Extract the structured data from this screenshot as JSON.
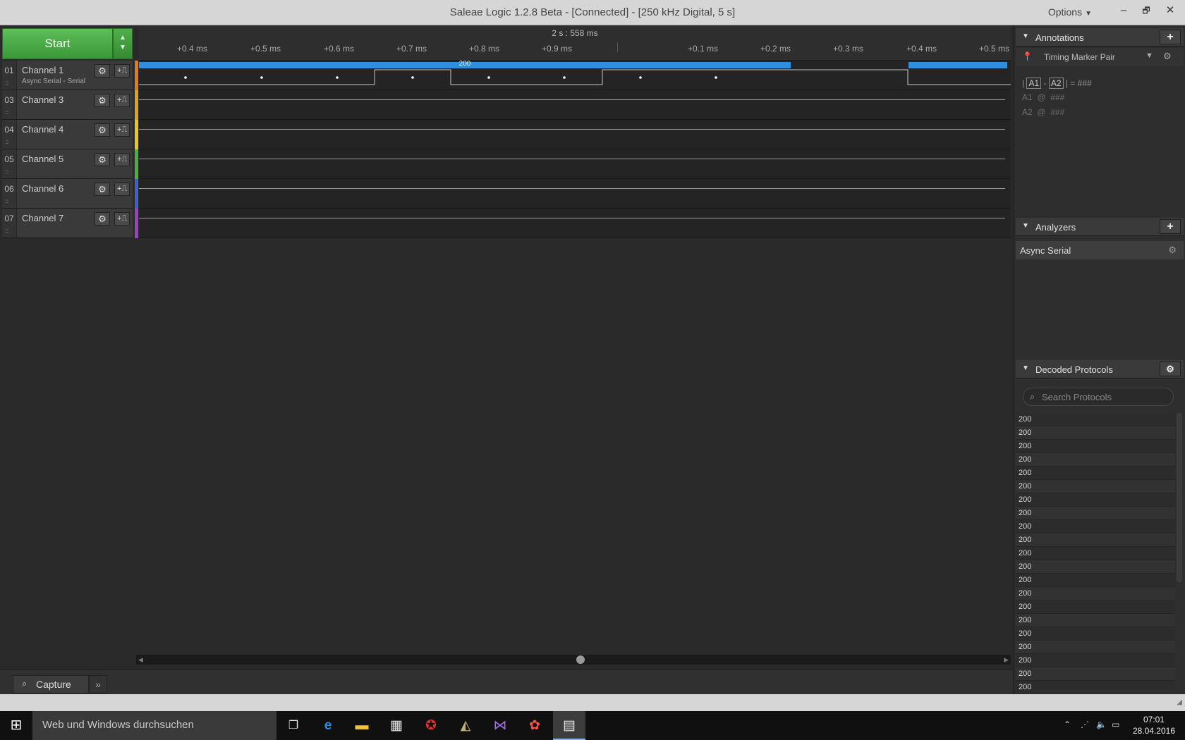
{
  "window": {
    "title": "Saleae Logic 1.2.8 Beta - [Connected] - [250 kHz Digital, 5 s]",
    "options_label": "Options",
    "minimize": "–",
    "maximize": "🗗",
    "close": "✕"
  },
  "toolbar": {
    "start_label": "Start"
  },
  "channels": [
    {
      "num": "01",
      "name": "Channel 1",
      "sub": "Async Serial - Serial",
      "color": "#e07b20"
    },
    {
      "num": "03",
      "name": "Channel 3",
      "sub": "",
      "color": "#e0a020"
    },
    {
      "num": "04",
      "name": "Channel 4",
      "sub": "",
      "color": "#e8c818"
    },
    {
      "num": "05",
      "name": "Channel 5",
      "sub": "",
      "color": "#4ab040"
    },
    {
      "num": "06",
      "name": "Channel 6",
      "sub": "",
      "color": "#4060d0"
    },
    {
      "num": "07",
      "name": "Channel 7",
      "sub": "",
      "color": "#9a40c8"
    }
  ],
  "timeline": {
    "center_time": "2 s : 558 ms",
    "ticks": [
      "+0.4 ms",
      "+0.5 ms",
      "+0.6 ms",
      "+0.7 ms",
      "+0.8 ms",
      "+0.9 ms",
      "+0.1 ms",
      "+0.2 ms",
      "+0.3 ms",
      "+0.4 ms",
      "+0.5 ms"
    ],
    "decoded_label": "200"
  },
  "bottom": {
    "capture_tab": "Capture",
    "more_tab": "»"
  },
  "annotations": {
    "title": "Annotations",
    "marker_label": "Timing Marker Pair",
    "diff_left": "A1",
    "diff_right": "A2",
    "diff_value": "###",
    "a1_label": "A1",
    "a1_value": "###",
    "a2_label": "A2",
    "a2_value": "###"
  },
  "analyzers": {
    "title": "Analyzers",
    "items": [
      "Async Serial"
    ]
  },
  "decoded": {
    "title": "Decoded Protocols",
    "search_placeholder": "Search Protocols",
    "rows": [
      "200",
      "200",
      "200",
      "200",
      "200",
      "200",
      "200",
      "200",
      "200",
      "200",
      "200",
      "200",
      "200",
      "200",
      "200",
      "200",
      "200",
      "200",
      "200",
      "200",
      "200"
    ]
  },
  "taskbar": {
    "search_text": "Web und Windows durchsuchen",
    "time": "07:01",
    "date": "28.04.2016"
  },
  "colors": {
    "accent_blue": "#2f8fdf",
    "start_green": "#4caf4a"
  }
}
